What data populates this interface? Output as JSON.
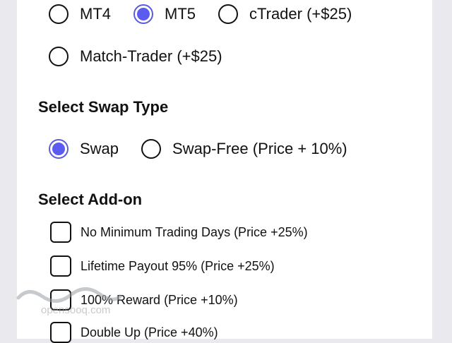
{
  "platform": {
    "options": [
      {
        "label": "MT4",
        "selected": false
      },
      {
        "label": "MT5",
        "selected": true
      },
      {
        "label": "cTrader (+$25)",
        "selected": false
      },
      {
        "label": "Match-Trader (+$25)",
        "selected": false
      }
    ]
  },
  "swap": {
    "title": "Select Swap Type",
    "options": [
      {
        "label": "Swap",
        "selected": true
      },
      {
        "label": "Swap-Free (Price + 10%)",
        "selected": false
      }
    ]
  },
  "addons": {
    "title": "Select Add-on",
    "items": [
      {
        "label": "No Minimum Trading Days (Price +25%)",
        "checked": false
      },
      {
        "label": "Lifetime Payout 95% (Price +25%)",
        "checked": false
      },
      {
        "label": "100% Reward (Price +10%)",
        "checked": false
      },
      {
        "label": "Double Up (Price +40%)",
        "checked": false
      }
    ]
  },
  "watermark": {
    "text": "opensooq.com"
  },
  "colors": {
    "accent": "#5b5bf0",
    "background": "#e9e9ee",
    "card": "#ffffff"
  }
}
